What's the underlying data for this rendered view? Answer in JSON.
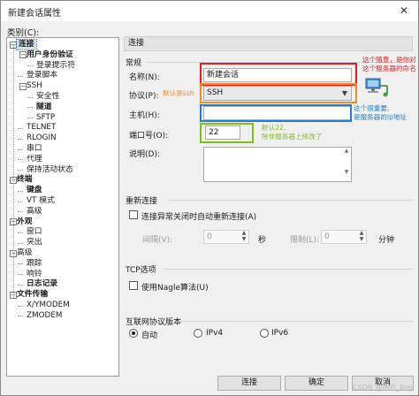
{
  "window": {
    "title": "新建会话属性",
    "close_glyph": "✕"
  },
  "category_label": "类别(C):",
  "tree": [
    {
      "label": "连接",
      "level": 0,
      "bold": true,
      "toggle": "−",
      "selected": true
    },
    {
      "label": "用户身份验证",
      "level": 1,
      "bold": true,
      "toggle": "−"
    },
    {
      "label": "登录提示符",
      "level": 2
    },
    {
      "label": "登录脚本",
      "level": 1
    },
    {
      "label": "SSH",
      "level": 1,
      "toggle": "−"
    },
    {
      "label": "安全性",
      "level": 2
    },
    {
      "label": "隧道",
      "level": 2,
      "bold": true
    },
    {
      "label": "SFTP",
      "level": 2
    },
    {
      "label": "TELNET",
      "level": 1
    },
    {
      "label": "RLOGIN",
      "level": 1
    },
    {
      "label": "串口",
      "level": 1
    },
    {
      "label": "代理",
      "level": 1
    },
    {
      "label": "保持活动状态",
      "level": 1
    },
    {
      "label": "终端",
      "level": 0,
      "bold": true,
      "toggle": "−"
    },
    {
      "label": "键盘",
      "level": 1,
      "bold": true
    },
    {
      "label": "VT 模式",
      "level": 1
    },
    {
      "label": "高级",
      "level": 1
    },
    {
      "label": "外观",
      "level": 0,
      "bold": true,
      "toggle": "−"
    },
    {
      "label": "窗口",
      "level": 1
    },
    {
      "label": "突出",
      "level": 1
    },
    {
      "label": "高级",
      "level": 0,
      "toggle": "−"
    },
    {
      "label": "跟踪",
      "level": 1
    },
    {
      "label": "响铃",
      "level": 1
    },
    {
      "label": "日志记录",
      "level": 1,
      "bold": true
    },
    {
      "label": "文件传输",
      "level": 0,
      "bold": true,
      "toggle": "−"
    },
    {
      "label": "X/YMODEM",
      "level": 1
    },
    {
      "label": "ZMODEM",
      "level": 1
    }
  ],
  "panel_header": "连接",
  "general": {
    "title": "常规",
    "name_label": "名称(N):",
    "name_value": "新建会话",
    "protocol_label": "协议(P):",
    "protocol_value": "SSH",
    "host_label": "主机(H):",
    "host_value": "",
    "port_label": "端口号(O):",
    "port_value": "22",
    "desc_label": "说明(D):",
    "desc_value": ""
  },
  "annotations": {
    "name": [
      "这个随意，是你对",
      "这个服务器的命名"
    ],
    "protocol": "默认是ssh",
    "host": [
      "这个很重要,",
      "是服务器的ip地址"
    ],
    "port": [
      "默认22,",
      "除非服务器上修改了"
    ]
  },
  "reconnect": {
    "title": "重新连接",
    "checkbox_label": "连接异常关闭时自动重新连接(A)",
    "interval_label": "间隔(V):",
    "interval_value": "0",
    "interval_unit": "秒",
    "limit_label": "限制(L):",
    "limit_value": "0",
    "limit_unit": "分钟"
  },
  "tcp": {
    "title": "TCP选项",
    "nagle_label": "使用Nagle算法(U)"
  },
  "ip": {
    "title": "互联网协议版本",
    "options": [
      "自动",
      "IPv4",
      "IPv6"
    ],
    "selected": "自动"
  },
  "buttons": {
    "connect": "连接",
    "ok": "确定",
    "cancel": "取消"
  },
  "watermark": "CSDN @李兆_ling",
  "colors": {
    "red": "#e02020",
    "orange": "#f08a1c",
    "blue": "#1e7fd8",
    "green": "#7fbf1a"
  }
}
